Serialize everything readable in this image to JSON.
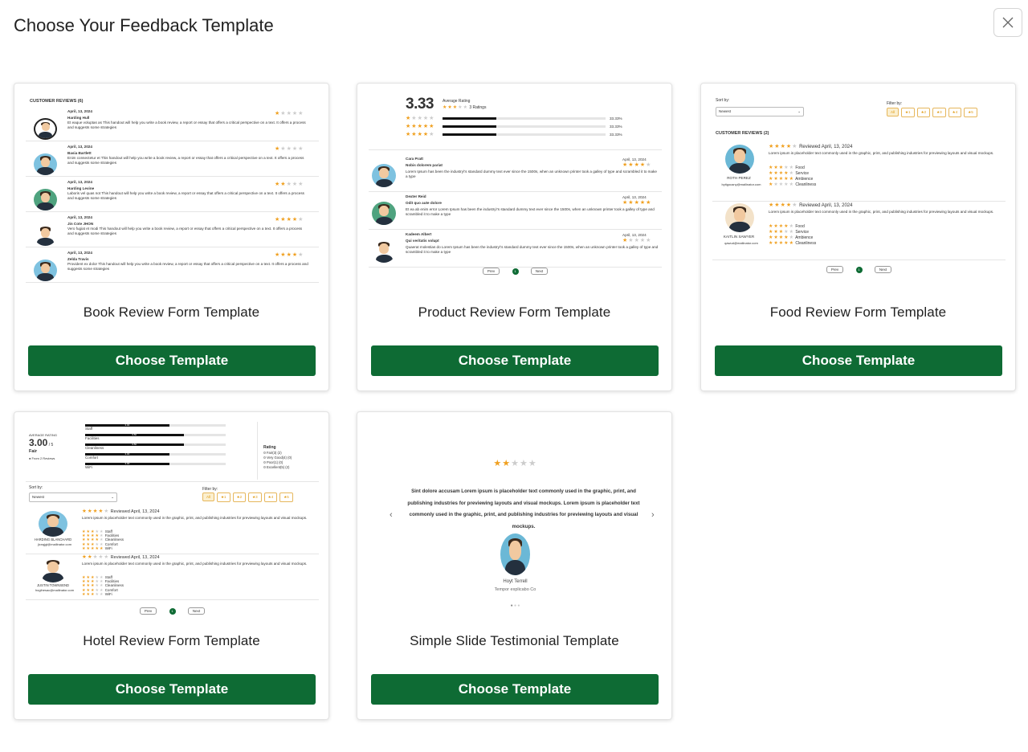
{
  "page": {
    "title": "Choose Your Feedback Template",
    "choose_label": "Choose Template"
  },
  "colors": {
    "primary": "#0e6b34",
    "star": "#f0a020"
  },
  "templates": [
    {
      "title": "Book Review Form Template"
    },
    {
      "title": "Product Review Form Template"
    },
    {
      "title": "Food Review Form Template"
    },
    {
      "title": "Hotel Review Form Template"
    },
    {
      "title": "Simple Slide Testimonial Template"
    }
  ],
  "book": {
    "heading": "CUSTOMER REVIEWS (6)",
    "reviews": [
      {
        "date": "April, 13, 2024",
        "name": "Harding Hull",
        "text": "Et eaque voluptas as This handout will help you write a book review, a report or essay that offers a critical perspective on a text. It offers a process and suggests some strategies",
        "stars": 1
      },
      {
        "date": "April, 13, 2024",
        "name": "Basia Bartlett",
        "text": "Enim consectetur et This handout will help you write a book review, a report or essay that offers a critical perspective on a text. It offers a process and suggests some strategies",
        "stars": 1
      },
      {
        "date": "April, 13, 2024",
        "name": "Harding Levine",
        "text": "Laboris vel quas not This handout will help you write a book review, a report or essay that offers a critical perspective on a text. It offers a process and suggests some strategies",
        "stars": 2
      },
      {
        "date": "April, 13, 2024",
        "name": "Jin Cote JHON",
        "text": "Vero fugiat et modi This handout will help you write a book review, a report or essay that offers a critical perspective on a text. It offers a process and suggests some strategies",
        "stars": 4
      },
      {
        "date": "April, 13, 2024",
        "name": "Zelda Travis",
        "text": "Provident ex dolor This handout will help you write a book review, a report or essay that offers a critical perspective on a text. It offers a process and suggests some strategies",
        "stars": 4
      }
    ]
  },
  "product": {
    "rating": "3.33",
    "rating_label": "Average Rating",
    "ratings_count": "3 Ratings",
    "bars": [
      {
        "stars": 1,
        "pct": "33.33%",
        "fill": 0.33
      },
      {
        "stars": 5,
        "pct": "33.33%",
        "fill": 0.33
      },
      {
        "stars": 4,
        "pct": "33.33%",
        "fill": 0.33
      }
    ],
    "reviews": [
      {
        "name": "Cara Pratt",
        "title": "Nobis dolorem pariat",
        "date": "April, 13, 2024",
        "stars": 4,
        "text": "Lorem Ipsum has been the industry\\'s standard dummy text ever since the 1500s, when an unknown printer took a galley of type and scrambled it to make a type"
      },
      {
        "name": "Dexter Reid",
        "title": "Odit quo aute dolore",
        "date": "April, 13, 2024",
        "stars": 5,
        "text": "Et ea ab enim error Lorem Ipsum has been the industry\\'s standard dummy text ever since the 1500s, when an unknown printer took a galley of type and scrambled it to make a type"
      },
      {
        "name": "Kadeem Albert",
        "title": "Qui veritatis volupt",
        "date": "April, 13, 2024",
        "stars": 1,
        "text": "Quaerat molestias do Lorem Ipsum has been the industry\\'s standard dummy text ever since the 1500s, when an unknown printer took a galley of type and scrambled it to make a type"
      }
    ],
    "prev": "Prev",
    "page": "1",
    "next": "Next"
  },
  "food": {
    "sort_label": "Sort by:",
    "sort_value": "Newest",
    "filter_label": "Filter by:",
    "filters": [
      "All",
      "★1",
      "★2",
      "★3",
      "★4",
      "★5"
    ],
    "heading": "CUSTOMER REVIEWS (2)",
    "reviews": [
      {
        "name": "ROTH PEREZ",
        "email": "bytigocany@mailinator.com",
        "stars": 4,
        "reviewed": "Reviewed April, 13, 2024",
        "text": "Lorem ipsum is placeholder text commonly used in the graphic, print, and publishing industries for previewing layouts and visual mockups.",
        "aspects": [
          {
            "label": "Food",
            "stars": 3
          },
          {
            "label": "Service",
            "stars": 4
          },
          {
            "label": "Ambience",
            "stars": 5
          },
          {
            "label": "Cleanliness",
            "stars": 1
          }
        ]
      },
      {
        "name": "KAITLIN SAWYER",
        "email": "qawud@mailinator.com",
        "stars": 4,
        "reviewed": "Reviewed April, 13, 2024",
        "text": "Lorem ipsum is placeholder text commonly used in the graphic, print, and publishing industries for previewing layouts and visual mockups.",
        "aspects": [
          {
            "label": "Food",
            "stars": 4
          },
          {
            "label": "Service",
            "stars": 3
          },
          {
            "label": "Ambience",
            "stars": 4
          },
          {
            "label": "Cleanliness",
            "stars": 5
          }
        ]
      }
    ],
    "prev": "Prev",
    "page": "1",
    "next": "Next"
  },
  "hotel": {
    "avg_label": "AVERAGE RATING",
    "avg": "3.00",
    "avg_suffix": "/ 5",
    "word": "Fair",
    "from": "From 2 Reviews",
    "categories": [
      {
        "label": "Staff",
        "value": "3.00",
        "fill": 0.6
      },
      {
        "label": "Facilities",
        "value": "3.50",
        "fill": 0.7
      },
      {
        "label": "Cleanliness",
        "value": "3.50",
        "fill": 0.7
      },
      {
        "label": "Comfort",
        "value": "3.00",
        "fill": 0.6
      },
      {
        "label": "WiFi",
        "value": "3.00",
        "fill": 0.6
      }
    ],
    "rating_label": "Rating",
    "rating_options": [
      "Fair(3) (2)",
      "Very Good(4) (0)",
      "Poor(1) (0)",
      "Excellent(5) (2)"
    ],
    "sort_label": "Sort by:",
    "sort_value": "Newest",
    "filter_label": "Filter by:",
    "filters": [
      "All",
      "★1",
      "★2",
      "★3",
      "★4",
      "★5"
    ],
    "reviews": [
      {
        "name": "HARDING BLANCHARD",
        "email": "jicnqjgl@mailinator.com",
        "stars": 4,
        "reviewed": "Reviewed April, 13, 2024",
        "text": "Lorem ipsum is placeholder text commonly used in the graphic, print, and publishing industries for previewing layouts and visual mockups.",
        "aspects": [
          {
            "label": "Staff",
            "stars": 3
          },
          {
            "label": "Facilities",
            "stars": 4
          },
          {
            "label": "Cleanliness",
            "stars": 4
          },
          {
            "label": "Comfort",
            "stars": 3
          },
          {
            "label": "WiFi",
            "stars": 5
          }
        ]
      },
      {
        "name": "JUSTIN TOWNSEND",
        "email": "hogihesac@mailinator.com",
        "stars": 2,
        "reviewed": "Reviewed April, 13, 2024",
        "text": "Lorem ipsum is placeholder text commonly used in the graphic, print, and publishing industries for previewing layouts and visual mockups.",
        "aspects": [
          {
            "label": "Staff",
            "stars": 3
          },
          {
            "label": "Facilities",
            "stars": 3
          },
          {
            "label": "Cleanliness",
            "stars": 3
          },
          {
            "label": "Comfort",
            "stars": 3
          },
          {
            "label": "WiFi",
            "stars": 3
          }
        ]
      }
    ],
    "prev": "Prev",
    "page": "1",
    "next": "Next"
  },
  "slide": {
    "stars": 2,
    "text": "Sint dolore accusam Lorem ipsum is placeholder text commonly used in the graphic, print, and publishing industries for previewing layouts and visual mockups. Lorem ipsum is placeholder text commonly used in the graphic, print, and publishing industries for previewing layouts and visual mockups.",
    "name": "Hoyt Terrell",
    "company": "Tempor explicabo Co",
    "prev_arrow": "‹",
    "next_arrow": "›"
  }
}
